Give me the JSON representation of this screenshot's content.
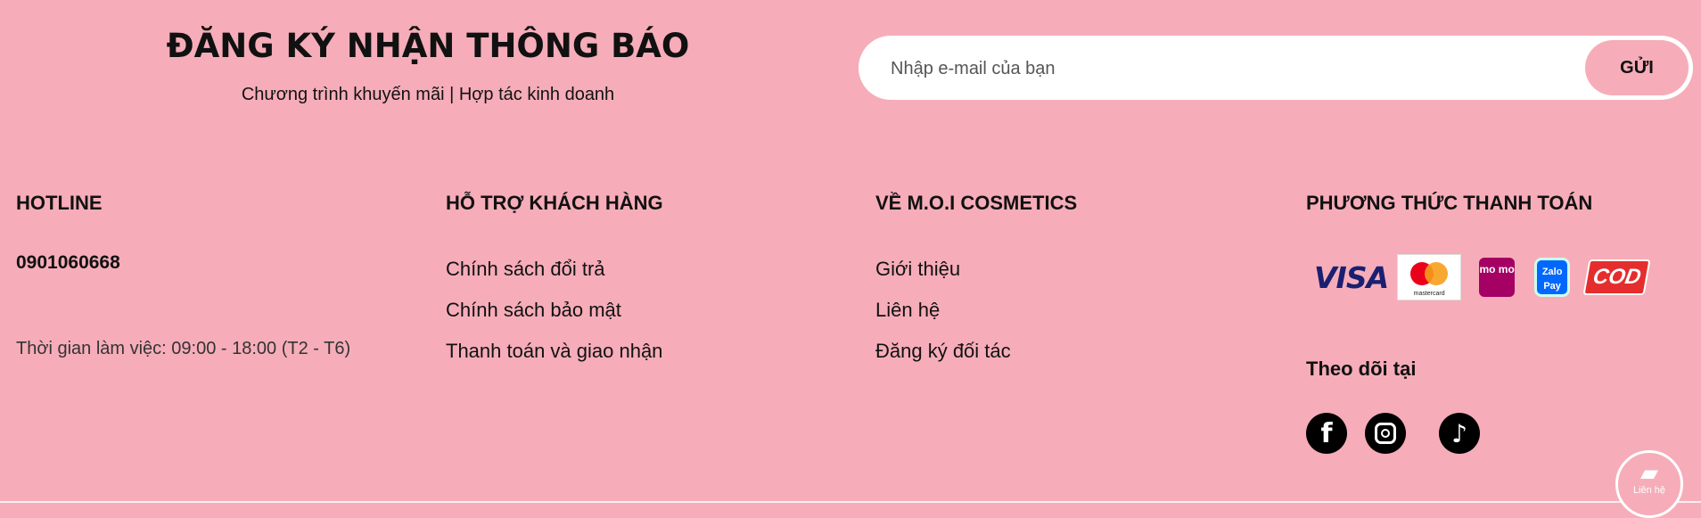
{
  "subscribe": {
    "title": "ĐĂNG KÝ NHẬN THÔNG BÁO",
    "description": "Chương trình khuyến mãi | Hợp tác kinh doanh",
    "email_placeholder": "Nhập e-mail của bạn",
    "email_value": "",
    "send_label": "GỬI"
  },
  "hotline": {
    "title": "HOTLINE",
    "number": "0901060668",
    "work_time": "Thời gian làm việc: 09:00 - 18:00 (T2 - T6)"
  },
  "support": {
    "title": "HỖ TRỢ KHÁCH HÀNG",
    "links": [
      "Chính sách đổi trả",
      "Chính sách bảo mật",
      "Thanh toán và giao nhận"
    ]
  },
  "about": {
    "title": "VỀ M.O.I COSMETICS",
    "links": [
      "Giới thiệu",
      "Liên hệ",
      "Đăng ký đối tác"
    ]
  },
  "payment": {
    "title": "PHƯƠNG THỨC THANH TOÁN",
    "methods": {
      "visa": "VISA",
      "mastercard": "mastercard",
      "momo": "mo mo",
      "zalopay": "Zalo Pay",
      "cod": "COD"
    },
    "follow_title": "Theo dõi tại",
    "social_icons": [
      "facebook-icon",
      "instagram-icon",
      "tiktok-icon"
    ]
  },
  "contact_float": {
    "label": "Liên hệ",
    "icon": "chat-icon"
  },
  "colors": {
    "background": "#f6adb9",
    "input_bg": "#ffffff",
    "text": "#111111"
  }
}
